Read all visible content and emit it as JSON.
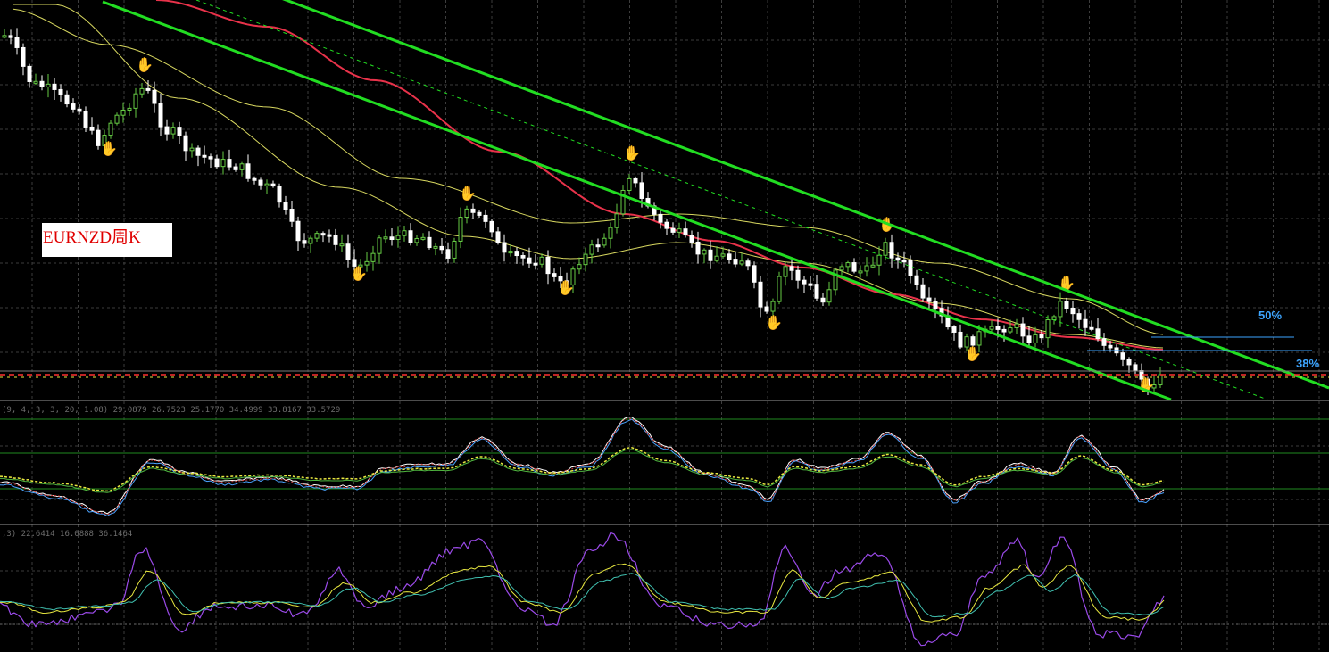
{
  "window": {
    "symbol_label": "EURNZD周K"
  },
  "colors": {
    "background": "#000000",
    "grid": "#3d3d3d",
    "bull": "#66cc44",
    "bear": "#ffffff",
    "channel": "#22dd22",
    "ma_slow": "#e8324a",
    "bands": "#d8d860",
    "fib": "#3da5ff",
    "fractal_up": "#c81414",
    "fractal_down": "#3a78e8",
    "osc_white": "#ffffff",
    "osc_blue": "#4ba3ff",
    "osc_red": "#d03a3a",
    "osc_yellow": "#e8e840",
    "osc_green": "#50b840",
    "osc_purple": "#9a4ae8",
    "osc_cyan": "#40c0b0",
    "level_green": "#1f8a1f",
    "price_red": "#ff3030",
    "price_yellow": "#e8e840"
  },
  "panels": {
    "main": {
      "fib_levels": [
        {
          "label": "50%"
        },
        {
          "label": "38%"
        }
      ]
    },
    "osc1": {
      "header": "(9, 4, 3, 3, 20, 1.08) 29.0879 26.7523 25.1770 34.4999 33.8167 33.5729"
    },
    "osc2": {
      "header": ",3) 22.6414 16.0888 36.1464"
    }
  },
  "chart_data": [
    {
      "type": "candlestick",
      "title": "EURNZD周K",
      "timeframe": "weekly",
      "trend": "down",
      "fib_levels": [
        "50%",
        "38%"
      ],
      "indicators": [
        "descending channel",
        "slow moving average",
        "envelope bands",
        "fractals"
      ],
      "grid": true
    },
    {
      "type": "line",
      "params": "(9, 4, 3, 3, 20, 1.08)",
      "values": [
        29.0879,
        26.7523,
        25.177,
        34.4999,
        33.8167,
        33.5729
      ],
      "grid": true
    },
    {
      "type": "line",
      "params": ",3)",
      "values": [
        22.6414,
        16.0888,
        36.1464
      ],
      "grid": true
    }
  ]
}
